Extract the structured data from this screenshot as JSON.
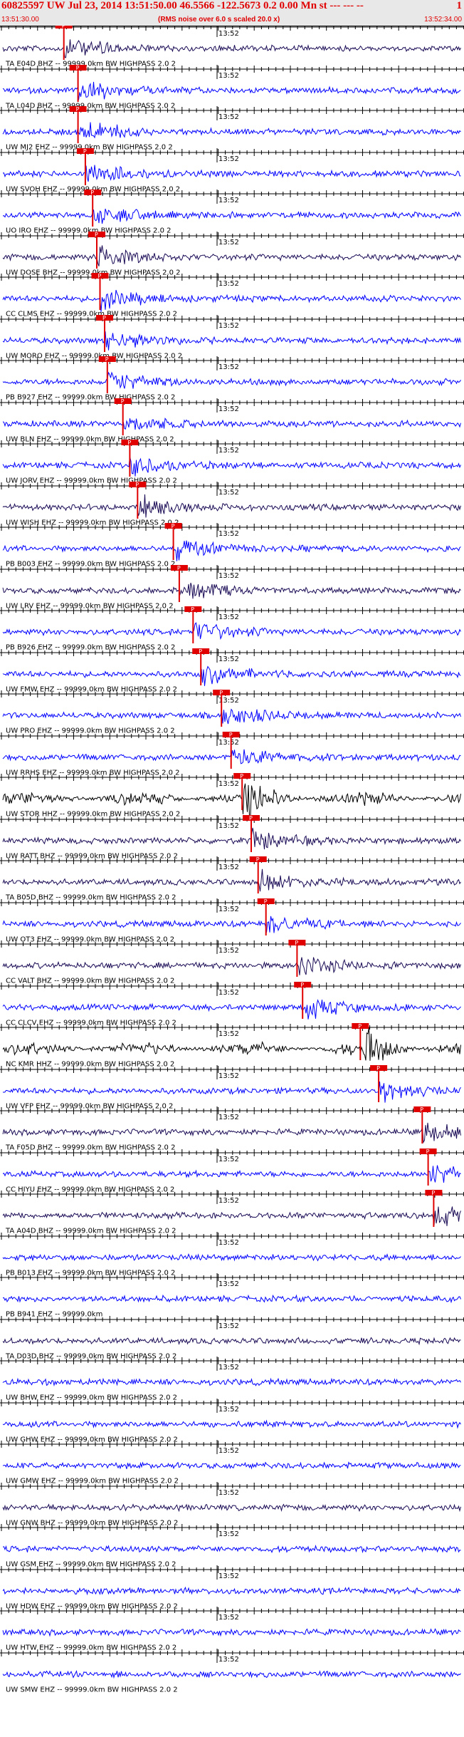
{
  "header": {
    "title": "60825597 UW Jul 23, 2014 13:51:50.00   46.5566 -122.5673  0.2 0.00 Mn st --- --- --",
    "page": "1",
    "start_time": "13:51:30.00",
    "end_time": "13:52:34.00",
    "subtitle": "(RMS noise over 6.0 s scaled 20.0 x)"
  },
  "time_marker": "13:52",
  "pick_label": "P",
  "colors": {
    "title": "#e00000",
    "blue": "#0000ff",
    "dark": "#1a0a55",
    "black": "#000000",
    "pick": "#e00000"
  },
  "traces": [
    {
      "label": "TA E04D BHZ -- 99999.0km BW  HIGHPASS  2.0  2",
      "color": "dark",
      "pick": 0.133
    },
    {
      "label": "TA L04D BHZ -- 99999.0km BW  HIGHPASS  2.0  2",
      "color": "blue",
      "pick": 0.164
    },
    {
      "label": "UW MJ2 EHZ -- 99999.0km BW  HIGHPASS  2.0  2",
      "color": "blue",
      "pick": 0.164
    },
    {
      "label": "UW SVOH EHZ -- 99999.0km BW  HIGHPASS  2.0  2",
      "color": "blue",
      "pick": 0.18
    },
    {
      "label": "UO IRO EHZ -- 99999.0km BW  HIGHPASS  2.0  2",
      "color": "blue",
      "pick": 0.196
    },
    {
      "label": "UW DOSE BHZ -- 99999.0km BW  HIGHPASS  2.0  2",
      "color": "dark",
      "pick": 0.205
    },
    {
      "label": "CC CLMS EHZ -- 99999.0km BW  HIGHPASS  2.0  2",
      "color": "blue",
      "pick": 0.212
    },
    {
      "label": "UW MORO EHZ -- 99999.0km BW  HIGHPASS  2.0  2",
      "color": "blue",
      "pick": 0.222
    },
    {
      "label": "PB B927 EHZ -- 99999.0km BW  HIGHPASS  2.0  2",
      "color": "blue",
      "pick": 0.228
    },
    {
      "label": "UW BLN EHZ -- 99999.0km BW  HIGHPASS  2.0  2",
      "color": "blue",
      "pick": 0.262
    },
    {
      "label": "UW JORV EHZ -- 99999.0km BW  HIGHPASS  2.0  2",
      "color": "blue",
      "pick": 0.277
    },
    {
      "label": "UW WISH EHZ -- 99999.0km BW  HIGHPASS  2.0  2",
      "color": "dark",
      "pick": 0.294
    },
    {
      "label": "PB B003 EHZ -- 99999.0km BW  HIGHPASS  2.0  2",
      "color": "blue",
      "pick": 0.372
    },
    {
      "label": "UW LRV EHZ -- 99999.0km BW  HIGHPASS  2.0  2",
      "color": "dark",
      "pick": 0.385
    },
    {
      "label": "PB B926 EHZ -- 99999.0km BW  HIGHPASS  2.0  2",
      "color": "blue",
      "pick": 0.415
    },
    {
      "label": "UW FMW EHZ -- 99999.0km BW  HIGHPASS  2.0  2",
      "color": "blue",
      "pick": 0.432
    },
    {
      "label": "UW PRO EHZ -- 99999.0km BW  HIGHPASS  2.0  2",
      "color": "blue",
      "pick": 0.477
    },
    {
      "label": "UW RRHS EHZ -- 99999.0km BW  HIGHPASS  2.0  2",
      "color": "blue",
      "pick": 0.498
    },
    {
      "label": "UW STOR HHZ -- 99999.0km BW  HIGHPASS  2.0  2",
      "color": "black",
      "pick": 0.522
    },
    {
      "label": "UW RATT BHZ -- 99999.0km BW  HIGHPASS  2.0  2",
      "color": "dark",
      "pick": 0.542
    },
    {
      "label": "TA B05D BHZ -- 99999.0km BW  HIGHPASS  2.0  2",
      "color": "dark",
      "pick": 0.557
    },
    {
      "label": "UW OT3 EHZ -- 99999.0km BW  HIGHPASS  2.0  2",
      "color": "blue",
      "pick": 0.574
    },
    {
      "label": "CC VALT BHZ -- 99999.0km BW  HIGHPASS  2.0  2",
      "color": "dark",
      "pick": 0.642
    },
    {
      "label": "CC CLCV EHZ -- 99999.0km BW  HIGHPASS  2.0  2",
      "color": "blue",
      "pick": 0.654
    },
    {
      "label": "NC KMR HHZ -- 99999.0km BW  HIGHPASS  2.0  2",
      "color": "black",
      "pick": 0.78
    },
    {
      "label": "UW VFP EHZ -- 99999.0km BW  HIGHPASS  2.0  2",
      "color": "blue",
      "pick": 0.82
    },
    {
      "label": "TA F05D BHZ -- 99999.0km BW  HIGHPASS  2.0  2",
      "color": "dark",
      "pick": 0.915
    },
    {
      "label": "CC HIYU EHZ -- 99999.0km BW  HIGHPASS  2.0  2",
      "color": "blue",
      "pick": 0.928
    },
    {
      "label": "TA A04D BHZ -- 99999.0km BW  HIGHPASS  2.0  2",
      "color": "dark",
      "pick": 0.94
    },
    {
      "label": "PB B013 EHZ -- 99999.0km BW  HIGHPASS  2.0  2",
      "color": "blue",
      "pick": null
    },
    {
      "label": "PB B941 EHZ -- 99999.0km",
      "color": "blue",
      "pick": null
    },
    {
      "label": "TA D03D BHZ -- 99999.0km BW  HIGHPASS  2.0  2",
      "color": "dark",
      "pick": null
    },
    {
      "label": "UW BHW EHZ -- 99999.0km BW  HIGHPASS  2.0  2",
      "color": "blue",
      "pick": null
    },
    {
      "label": "UW GHW EHZ -- 99999.0km BW  HIGHPASS  2.0  2",
      "color": "blue",
      "pick": null
    },
    {
      "label": "UW GMW EHZ -- 99999.0km BW  HIGHPASS  2.0  2",
      "color": "blue",
      "pick": null
    },
    {
      "label": "UW GNW BHZ -- 99999.0km BW  HIGHPASS  2.0  2",
      "color": "dark",
      "pick": null
    },
    {
      "label": "UW GSM EHZ -- 99999.0km BW  HIGHPASS  2.0  2",
      "color": "blue",
      "pick": null
    },
    {
      "label": "UW HDW EHZ -- 99999.0km BW  HIGHPASS  2.0  2",
      "color": "blue",
      "pick": null
    },
    {
      "label": "UW HTW EHZ -- 99999.0km BW  HIGHPASS  2.0  2",
      "color": "blue",
      "pick": null
    },
    {
      "label": "UW SMW EHZ -- 99999.0km BW  HIGHPASS  2.0  2",
      "color": "blue",
      "pick": null
    }
  ]
}
